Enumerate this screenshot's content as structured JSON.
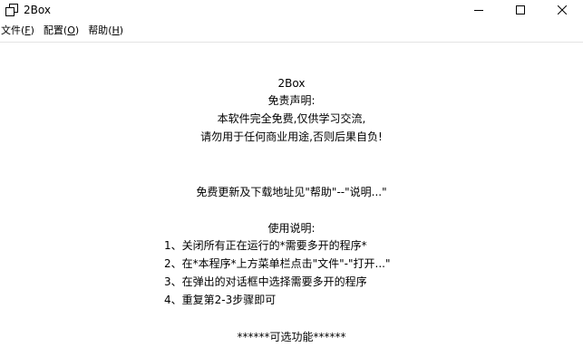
{
  "window": {
    "title": "2Box",
    "controls": {
      "minimize": "minimize",
      "maximize": "maximize",
      "close": "close"
    }
  },
  "menubar": {
    "items": [
      {
        "label": "文件",
        "accel_paren_open": "(",
        "accel": "F",
        "accel_paren_close": ")"
      },
      {
        "label": "配置",
        "accel_paren_open": "(",
        "accel": "O",
        "accel_paren_close": ")"
      },
      {
        "label": "帮助",
        "accel_paren_open": "(",
        "accel": "H",
        "accel_paren_close": ")"
      }
    ]
  },
  "content": {
    "app_name": "2Box",
    "disclaimer_title": "免责声明:",
    "disclaimer_line1": "本软件完全免费,仅供学习交流,",
    "disclaimer_line2": "请勿用于任何商业用途,否则后果自负!",
    "update_note": "免费更新及下载地址见\"帮助\"--\"说明...\"",
    "usage_title": "使用说明:",
    "steps": [
      "1、关闭所有正在运行的*需要多开的程序*",
      "2、在*本程序*上方菜单栏点击\"文件\"-\"打开...\"",
      "3、在弹出的对话框中选择需要多开的程序",
      "4、重复第2-3步骤即可"
    ],
    "optional_title": "******可选功能******"
  }
}
